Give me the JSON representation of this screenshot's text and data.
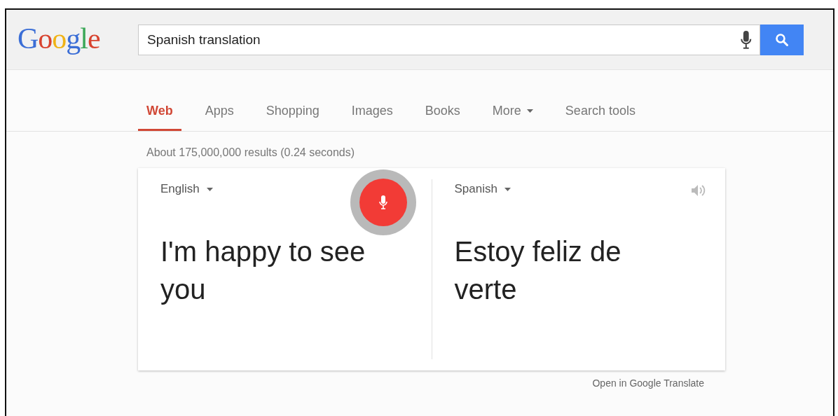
{
  "logo": "Google",
  "search": {
    "value": "Spanish translation"
  },
  "tabs": [
    {
      "label": "Web",
      "selected": true,
      "dropdown": false
    },
    {
      "label": "Apps",
      "selected": false,
      "dropdown": false
    },
    {
      "label": "Shopping",
      "selected": false,
      "dropdown": false
    },
    {
      "label": "Images",
      "selected": false,
      "dropdown": false
    },
    {
      "label": "Books",
      "selected": false,
      "dropdown": false
    },
    {
      "label": "More",
      "selected": false,
      "dropdown": true
    },
    {
      "label": "Search tools",
      "selected": false,
      "dropdown": false
    }
  ],
  "result_stats": "About 175,000,000 results (0.24 seconds)",
  "translator": {
    "source": {
      "language": "English",
      "text": "I'm happy to see you"
    },
    "target": {
      "language": "Spanish",
      "text": "Estoy feliz de verte"
    },
    "listening": true
  },
  "open_link": "Open in Google Translate"
}
